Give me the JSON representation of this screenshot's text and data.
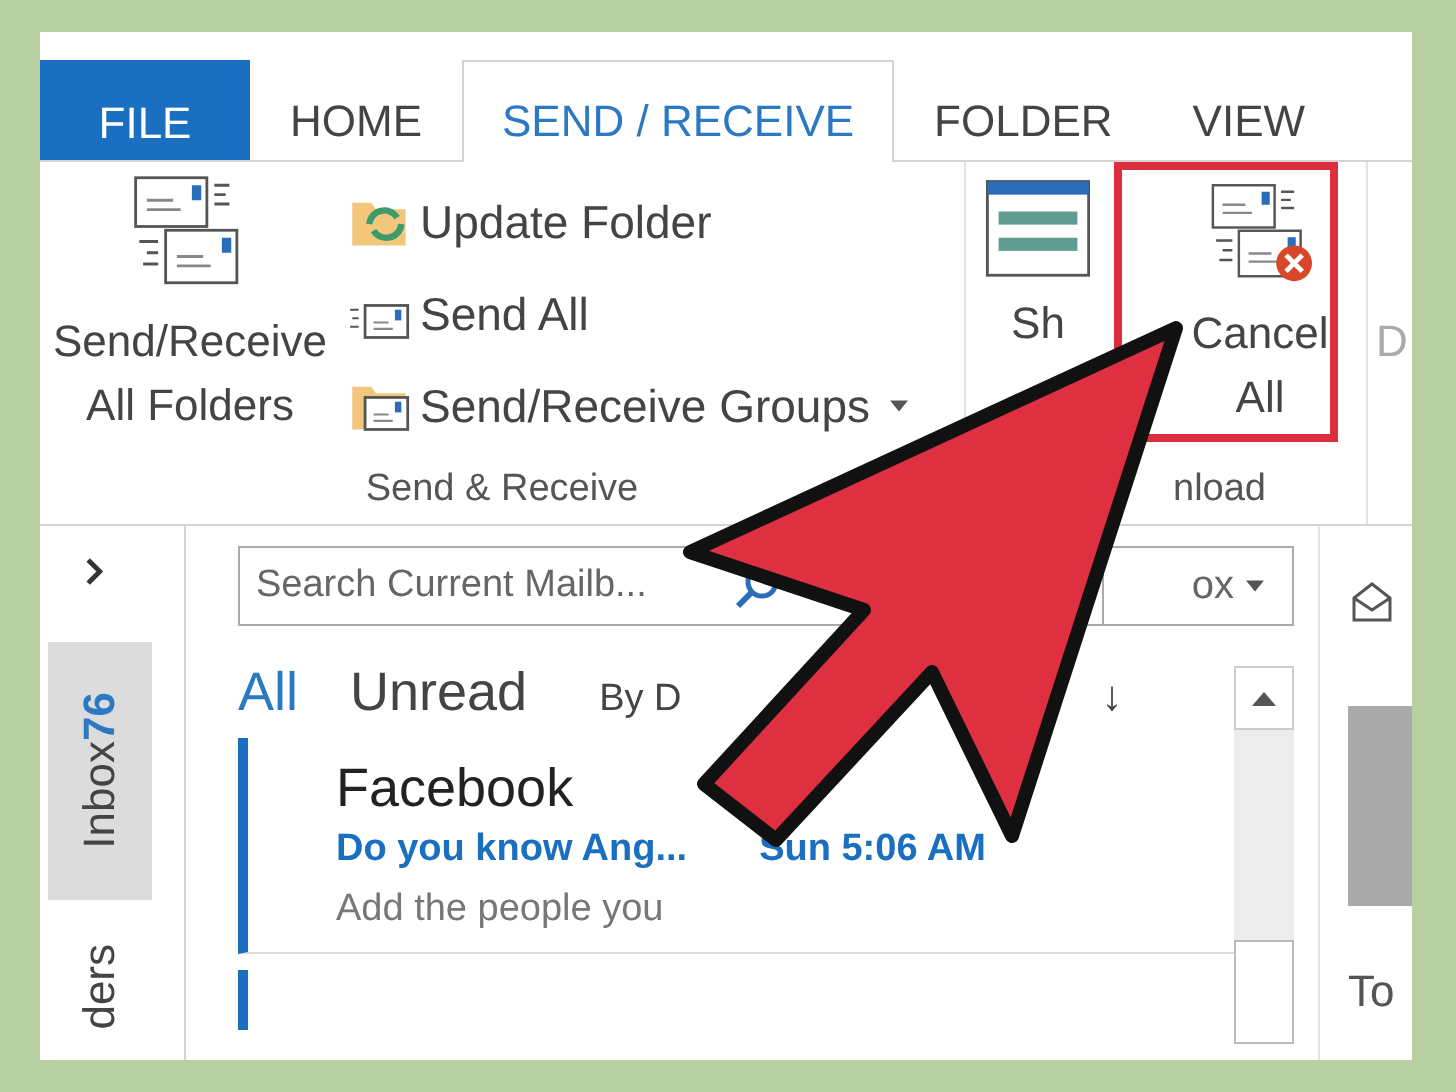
{
  "tabs": [
    {
      "label": "FILE",
      "kind": "file",
      "selected": false
    },
    {
      "label": "HOME",
      "kind": "tab",
      "selected": false
    },
    {
      "label": "SEND / RECEIVE",
      "kind": "tab",
      "selected": true
    },
    {
      "label": "FOLDER",
      "kind": "tab",
      "selected": false
    },
    {
      "label": "VIEW",
      "kind": "tab",
      "selected": false
    }
  ],
  "ribbon": {
    "groups": [
      {
        "label": "Send & Receive",
        "large_buttons": [
          {
            "kind": "send-receive",
            "label_lines": [
              "Send/Receive",
              "All Folders"
            ],
            "highlighted": false
          }
        ],
        "small_buttons": [
          {
            "kind": "update",
            "label": "Update Folder",
            "dropdown": false
          },
          {
            "kind": "send",
            "label": "Send All",
            "dropdown": false
          },
          {
            "kind": "groups",
            "label": "Send/Receive Groups",
            "dropdown": true
          }
        ]
      },
      {
        "label": "nload",
        "large_buttons": [
          {
            "kind": "show",
            "label_lines": [
              "Sh"
            ],
            "highlighted": false
          },
          {
            "kind": "cancel",
            "label_lines": [
              "Cancel",
              "All"
            ],
            "highlighted": true
          }
        ]
      },
      {
        "large_buttons": [
          {
            "kind": "partial",
            "label_lines": [
              "D"
            ],
            "highlighted": false
          }
        ]
      }
    ]
  },
  "nav": {
    "items": [
      {
        "label": "Inbox",
        "count": "76",
        "selected": true
      },
      {
        "label": "ders",
        "selected": false
      }
    ]
  },
  "search": {
    "placeholder": "Search Current Mailb..."
  },
  "scope": {
    "value": "ox"
  },
  "filters": [
    {
      "label": "All",
      "selected": true
    },
    {
      "label": "Unread",
      "selected": false
    }
  ],
  "sort": {
    "by": "By D",
    "order": "↓"
  },
  "messages": [
    {
      "sender": "Facebook",
      "subject": "Do you know Ang...",
      "time": "Sun 5:06 AM",
      "preview": "Add the people you",
      "unread": true
    }
  ],
  "reading_pane": {
    "text": "To"
  }
}
